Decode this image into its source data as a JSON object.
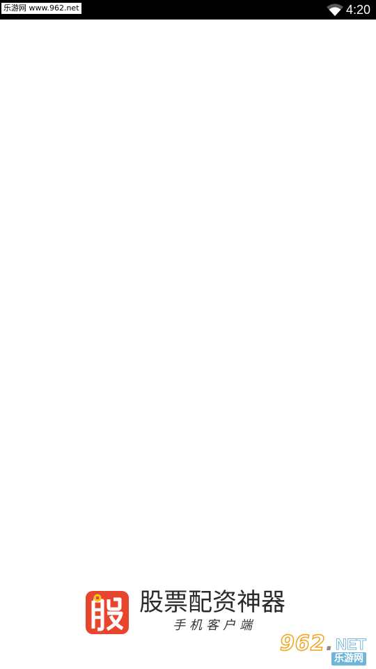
{
  "status_bar": {
    "watermark": "乐游网 www.962.net",
    "time": "4:20",
    "wifi_icon": "wifi-signal-icon"
  },
  "splash": {
    "logo_glyph": "股",
    "logo_icon": "stock-app-logo-icon",
    "title": "股票配资神器",
    "subtitle": "手机客户端"
  },
  "watermark": {
    "number": "962",
    "dot": ".",
    "domain": "NET",
    "site_name": "乐游网"
  },
  "colors": {
    "status_bar_bg": "#000000",
    "logo_bg": "#e8452e",
    "logo_accent": "#f5c518",
    "watermark_orange": "#f0a21c",
    "watermark_blue": "#6db6d9"
  }
}
